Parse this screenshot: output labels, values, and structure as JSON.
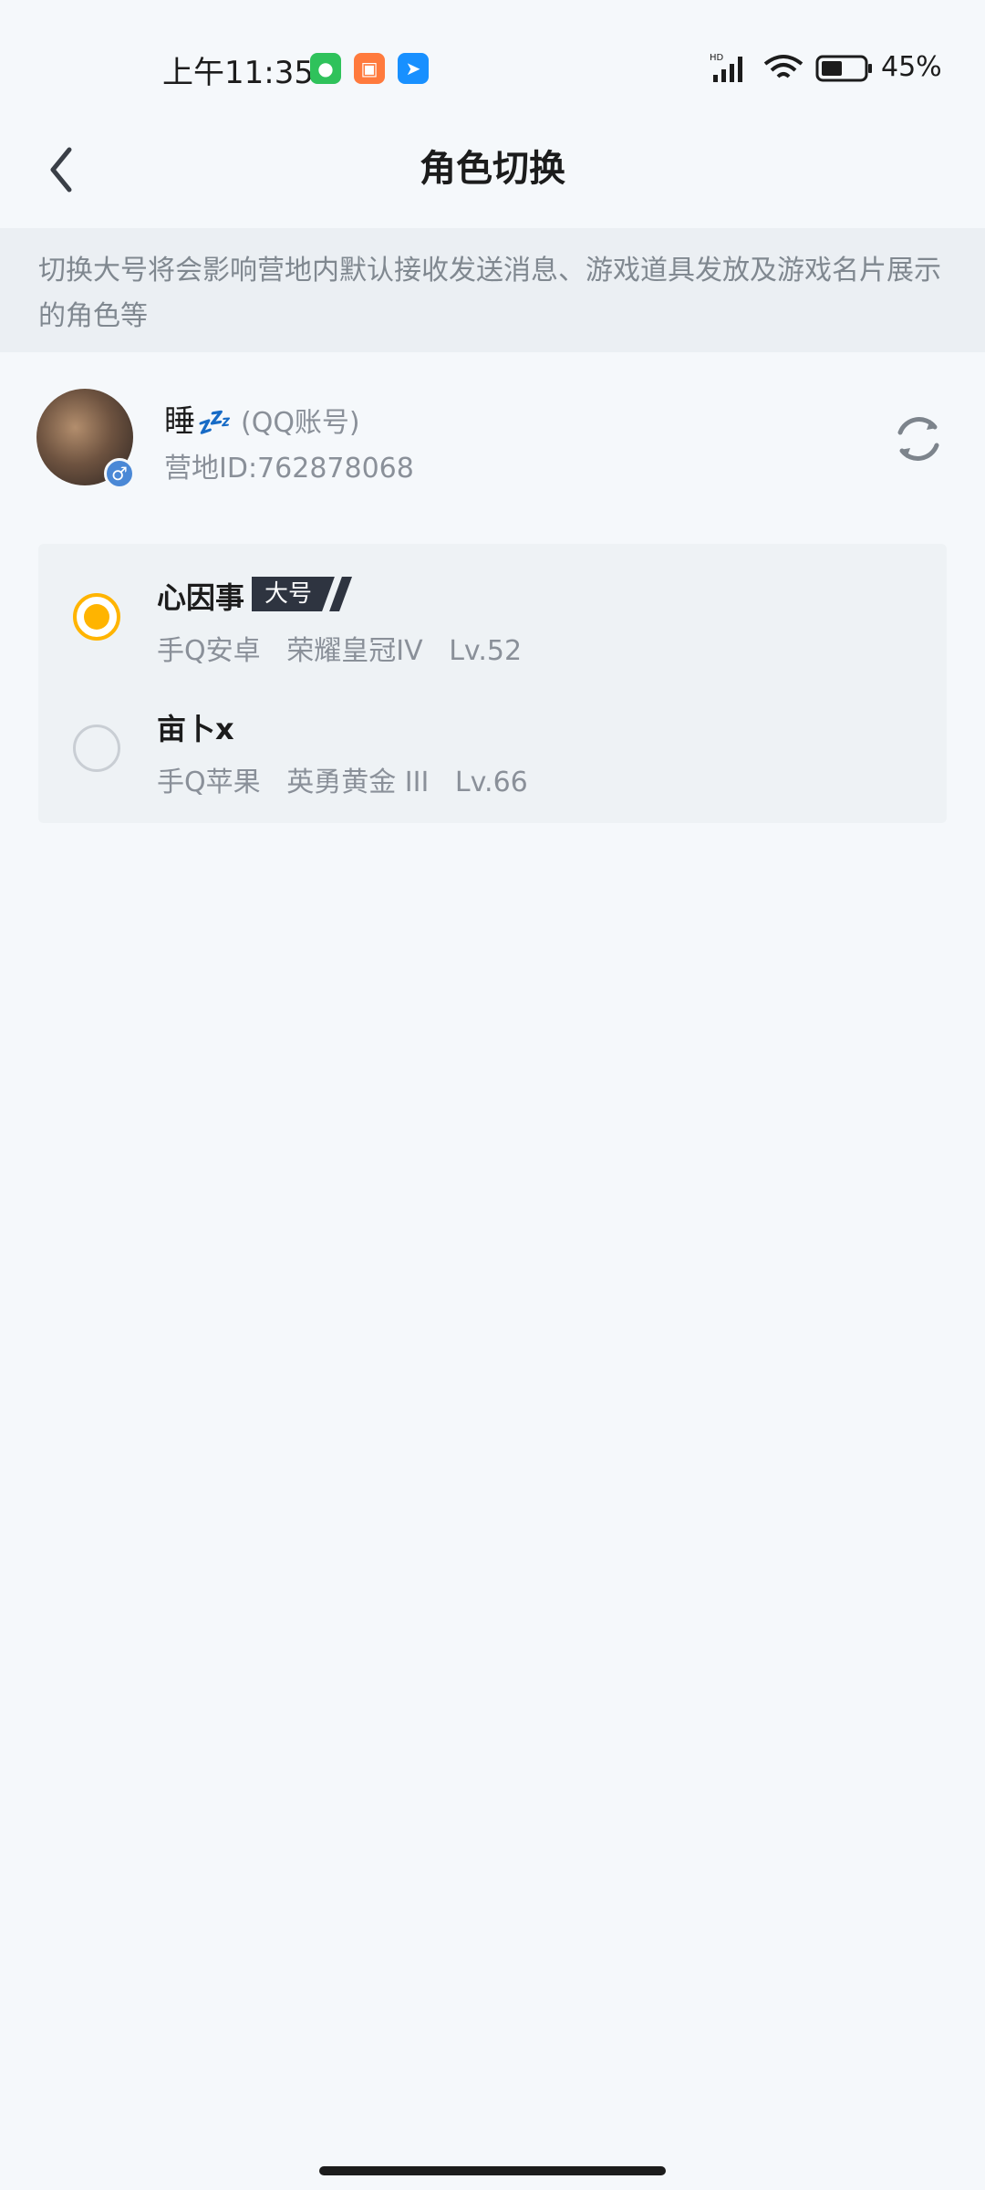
{
  "status_bar": {
    "time": "上午11:35",
    "battery": "45%",
    "icons": [
      "wechat-icon",
      "taobao-icon",
      "dingtalk-icon",
      "hd-signal-icon",
      "wifi-icon",
      "battery-icon"
    ]
  },
  "header": {
    "title": "角色切换"
  },
  "notice": {
    "text": "切换大号将会影响营地内默认接收发送消息、游戏道具发放及游戏名片展示的角色等"
  },
  "account": {
    "name": "睡",
    "name_emoji": "💤",
    "type": "(QQ账号)",
    "id": "营地ID:762878068"
  },
  "roles": [
    {
      "name": "心因事",
      "badge": "大号",
      "detail": "手Q安卓   荣耀皇冠IV   Lv.52",
      "selected": true
    },
    {
      "name": "亩卜x",
      "badge": "",
      "detail": "手Q苹果   英勇黄金 III   Lv.66",
      "selected": false
    }
  ],
  "colors": {
    "accent": "#ffb400",
    "background": "#f5f8fb",
    "notice_bg": "#ebeff3",
    "card_bg": "#eef2f5"
  }
}
